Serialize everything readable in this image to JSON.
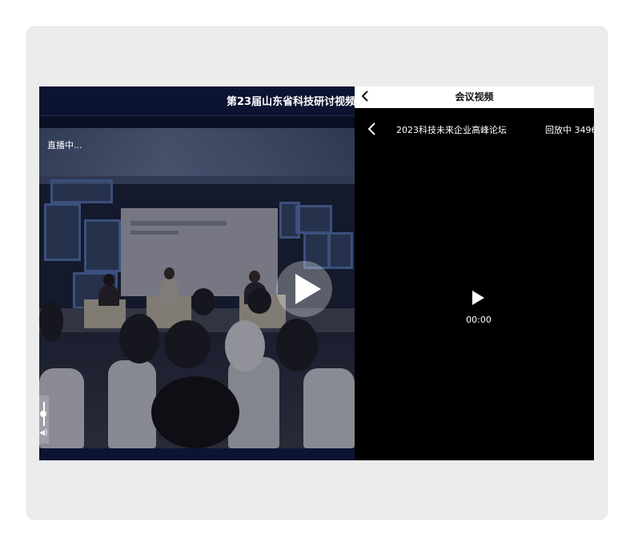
{
  "left_player": {
    "title": "第23届山东省科技研讨视频",
    "live_label": "直播中..."
  },
  "right_panel": {
    "header_title": "会议视频",
    "video_title": "2023科技未来企业高峰论坛",
    "status_text": "回放中 3496",
    "time": "00:00"
  },
  "icons": {
    "back": "chevron-left-icon",
    "play": "play-icon",
    "volume": "volume-icon"
  },
  "colors": {
    "card_bg": "#ececed",
    "left_bg": "#0a1024",
    "right_bg": "#000000"
  }
}
